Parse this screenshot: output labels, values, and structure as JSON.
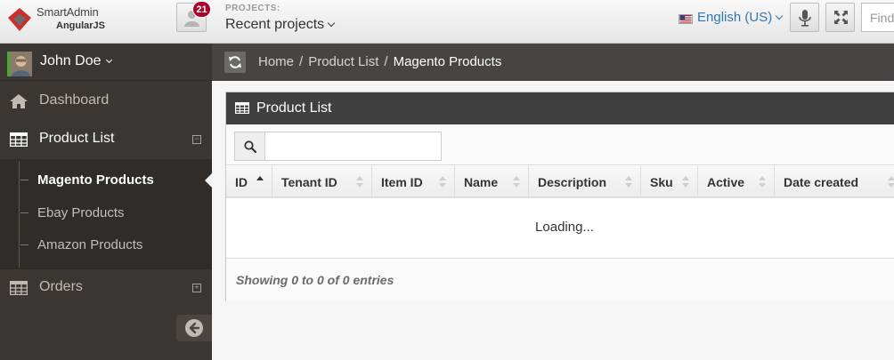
{
  "header": {
    "logo_title": "SmartAdmin",
    "logo_subtitle": "AngularJS",
    "activity_count": "21",
    "projects_label": "PROJECTS:",
    "projects_value": "Recent projects",
    "language": "English (US)",
    "search_placeholder": "Find"
  },
  "sidebar": {
    "user_name": "John Doe",
    "items": [
      {
        "label": "Dashboard",
        "icon": "home-icon"
      },
      {
        "label": "Product List",
        "icon": "table-icon",
        "toggle": "−"
      },
      {
        "label": "Orders",
        "icon": "table-icon",
        "toggle": "+"
      }
    ],
    "subitems": [
      {
        "label": "Magento Products",
        "active": true
      },
      {
        "label": "Ebay Products",
        "active": false
      },
      {
        "label": "Amazon Products",
        "active": false
      }
    ]
  },
  "breadcrumb": {
    "items": [
      "Home",
      "Product List",
      "Magento Products"
    ],
    "separator": "/"
  },
  "widget": {
    "title": "Product List",
    "search_placeholder": "",
    "columns": [
      "ID",
      "Tenant ID",
      "Item ID",
      "Name",
      "Description",
      "Sku",
      "Active",
      "Date created"
    ],
    "loading_text": "Loading...",
    "footer_info": "Showing 0 to 0 of 0 entries"
  },
  "colors": {
    "sidebar_bg": "#3a3633",
    "ribbon_bg": "#474544",
    "widget_header_bg": "#404040",
    "badge_bg": "#a90329",
    "link_blue": "#3276b1"
  }
}
